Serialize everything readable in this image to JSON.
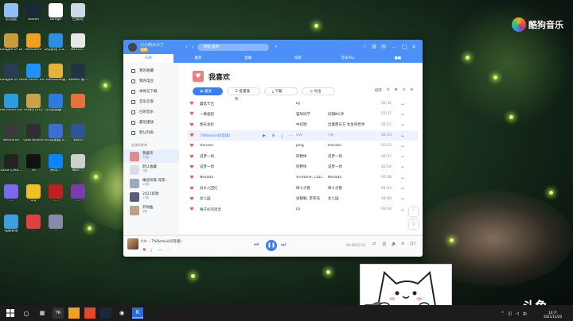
{
  "desktop": {
    "icons": [
      {
        "label": "此电脑",
        "color": "#8fc0f0"
      },
      {
        "label": "Steam",
        "color": "#1b2838"
      },
      {
        "label": "bongo",
        "color": "#ffffff"
      },
      {
        "label": "回收站",
        "color": "#cfd8e6"
      },
      {
        "label": "League of Legends",
        "color": "#c89b3c"
      },
      {
        "label": "WeGame",
        "color": "#f0a020"
      },
      {
        "label": "QQ游戏 1.2 ...",
        "color": "#2e8fe0"
      },
      {
        "label": "Win10...",
        "color": "#e8e8e8"
      },
      {
        "label": "League of Legends",
        "color": "#2a3c55"
      },
      {
        "label": "Microsoft Edge",
        "color": "#1e90ff"
      },
      {
        "label": "WeGame版",
        "color": "#e8b23a"
      },
      {
        "label": "Steam 版...",
        "color": "#223344"
      },
      {
        "label": "Microsoft Edge",
        "color": "#2e9be0"
      },
      {
        "label": "PUBG LITE",
        "color": "#c9a24a"
      },
      {
        "label": "UU加速器 ...",
        "color": "#2d7ae0"
      },
      {
        "label": "...",
        "color": "#e8703a"
      },
      {
        "label": "WeGame",
        "color": "#3a3a3a"
      },
      {
        "label": "OBS Studio",
        "color": "#302e31"
      },
      {
        "label": "UU加速器 2...",
        "color": "#3b6fd4"
      },
      {
        "label": "Word",
        "color": "#2b5797"
      },
      {
        "label": "Dota Crea...",
        "color": "#222222"
      },
      {
        "label": "TR",
        "color": "#111111"
      },
      {
        "label": "腾讯...",
        "color": "#0a84ff"
      },
      {
        "label": "wps ...",
        "color": "#cfcfcf"
      },
      {
        "label": "...",
        "color": "#7b68ee"
      },
      {
        "label": "QQ",
        "color": "#f0c020"
      },
      {
        "label": "...",
        "color": "#c02020"
      },
      {
        "label": "...",
        "color": "#7a3ab0"
      },
      {
        "label": "电脑管家",
        "color": "#3a9ee0"
      },
      {
        "label": "...",
        "color": "#e04040"
      },
      {
        "label": "...",
        "color": "#8888aa"
      }
    ],
    "brand": "酷狗音乐"
  },
  "player_window": {
    "user": {
      "name": "小小的大小丁",
      "badge": "VIP"
    },
    "search_placeholder": "搜索 酷狗",
    "tabs": [
      "乐库",
      "推荐",
      "直播",
      "探索",
      "音乐Pay",
      "■■"
    ],
    "active_tab_index": 0,
    "sidebar": {
      "nav": [
        "我的收藏",
        "我的电台",
        "本地与下载",
        "音乐云盘",
        "已购音乐",
        "最近播放",
        "默认列表"
      ],
      "section_header": "创建的歌单",
      "playlists": [
        {
          "title": "我喜欢",
          "sub": "99首",
          "color": "#e28b8b",
          "selected": true
        },
        {
          "title": "默认收藏",
          "sub": "1首",
          "color": "#d8dfe8",
          "selected": false
        },
        {
          "title": "睡前听歌 背景...",
          "sub": "10首",
          "color": "#9aa9c0",
          "selected": false
        },
        {
          "title": "2021新歌",
          "sub": "12首",
          "color": "#5b5b7a",
          "selected": false
        },
        {
          "title": "开场曲",
          "sub": "4首",
          "color": "#bfa089",
          "selected": false
        }
      ]
    },
    "main": {
      "title": "我喜欢",
      "actions": [
        "播放",
        "批量操作",
        "下载",
        "导出"
      ],
      "tools": [
        "排序",
        "≡",
        "⊞",
        "⊙",
        "⊕"
      ],
      "songs": [
        {
          "title": "蘑菇卡吉",
          "artist": "DJ",
          "album": "",
          "duration": "02:31"
        },
        {
          "title": "一路相思",
          "artist": "猫咪同学",
          "album": "同期NG手",
          "duration": "01:37"
        },
        {
          "title": "明天会好",
          "artist": "中召明",
          "album": "出塞西东方 生生阳世界",
          "duration": "02:57"
        },
        {
          "title": "7%Remix(抖音版)",
          "artist": "V.A-",
          "album": "7%",
          "duration": "02:53",
          "highlighted": true
        },
        {
          "title": "Horizon",
          "artist": "Jang",
          "album": "Horizon",
          "duration": "03:23"
        },
        {
          "title": "说梦一场",
          "artist": "阿野体",
          "album": "说梦一场",
          "duration": "02:47"
        },
        {
          "title": "说梦一场",
          "artist": "阿野体",
          "album": "说梦一场",
          "duration": "02:54"
        },
        {
          "title": "Nevada",
          "artist": "Vicetone, Cozi...",
          "album": "Nevada",
          "duration": "03:28"
        },
        {
          "title": "异乡儿回忆",
          "artist": "梓十点看",
          "album": "梓十点看",
          "duration": "04:03"
        },
        {
          "title": "女儿国",
          "artist": "张靓颖, 李荣浩",
          "album": "女儿国",
          "duration": "04:09"
        },
        {
          "title": "格子衫的思念",
          "artist": "DJ",
          "album": "",
          "duration": "03:29"
        }
      ]
    },
    "now_playing": {
      "title": "V.A- - 7%Remix(抖音版)",
      "time": "00:00/02:53",
      "progress": 0.0,
      "volume_label": "217"
    }
  },
  "overlay": {
    "streaming_logo": "斗鱼"
  },
  "taskbar": {
    "time": "10:??",
    "date": "2021/12/20"
  }
}
